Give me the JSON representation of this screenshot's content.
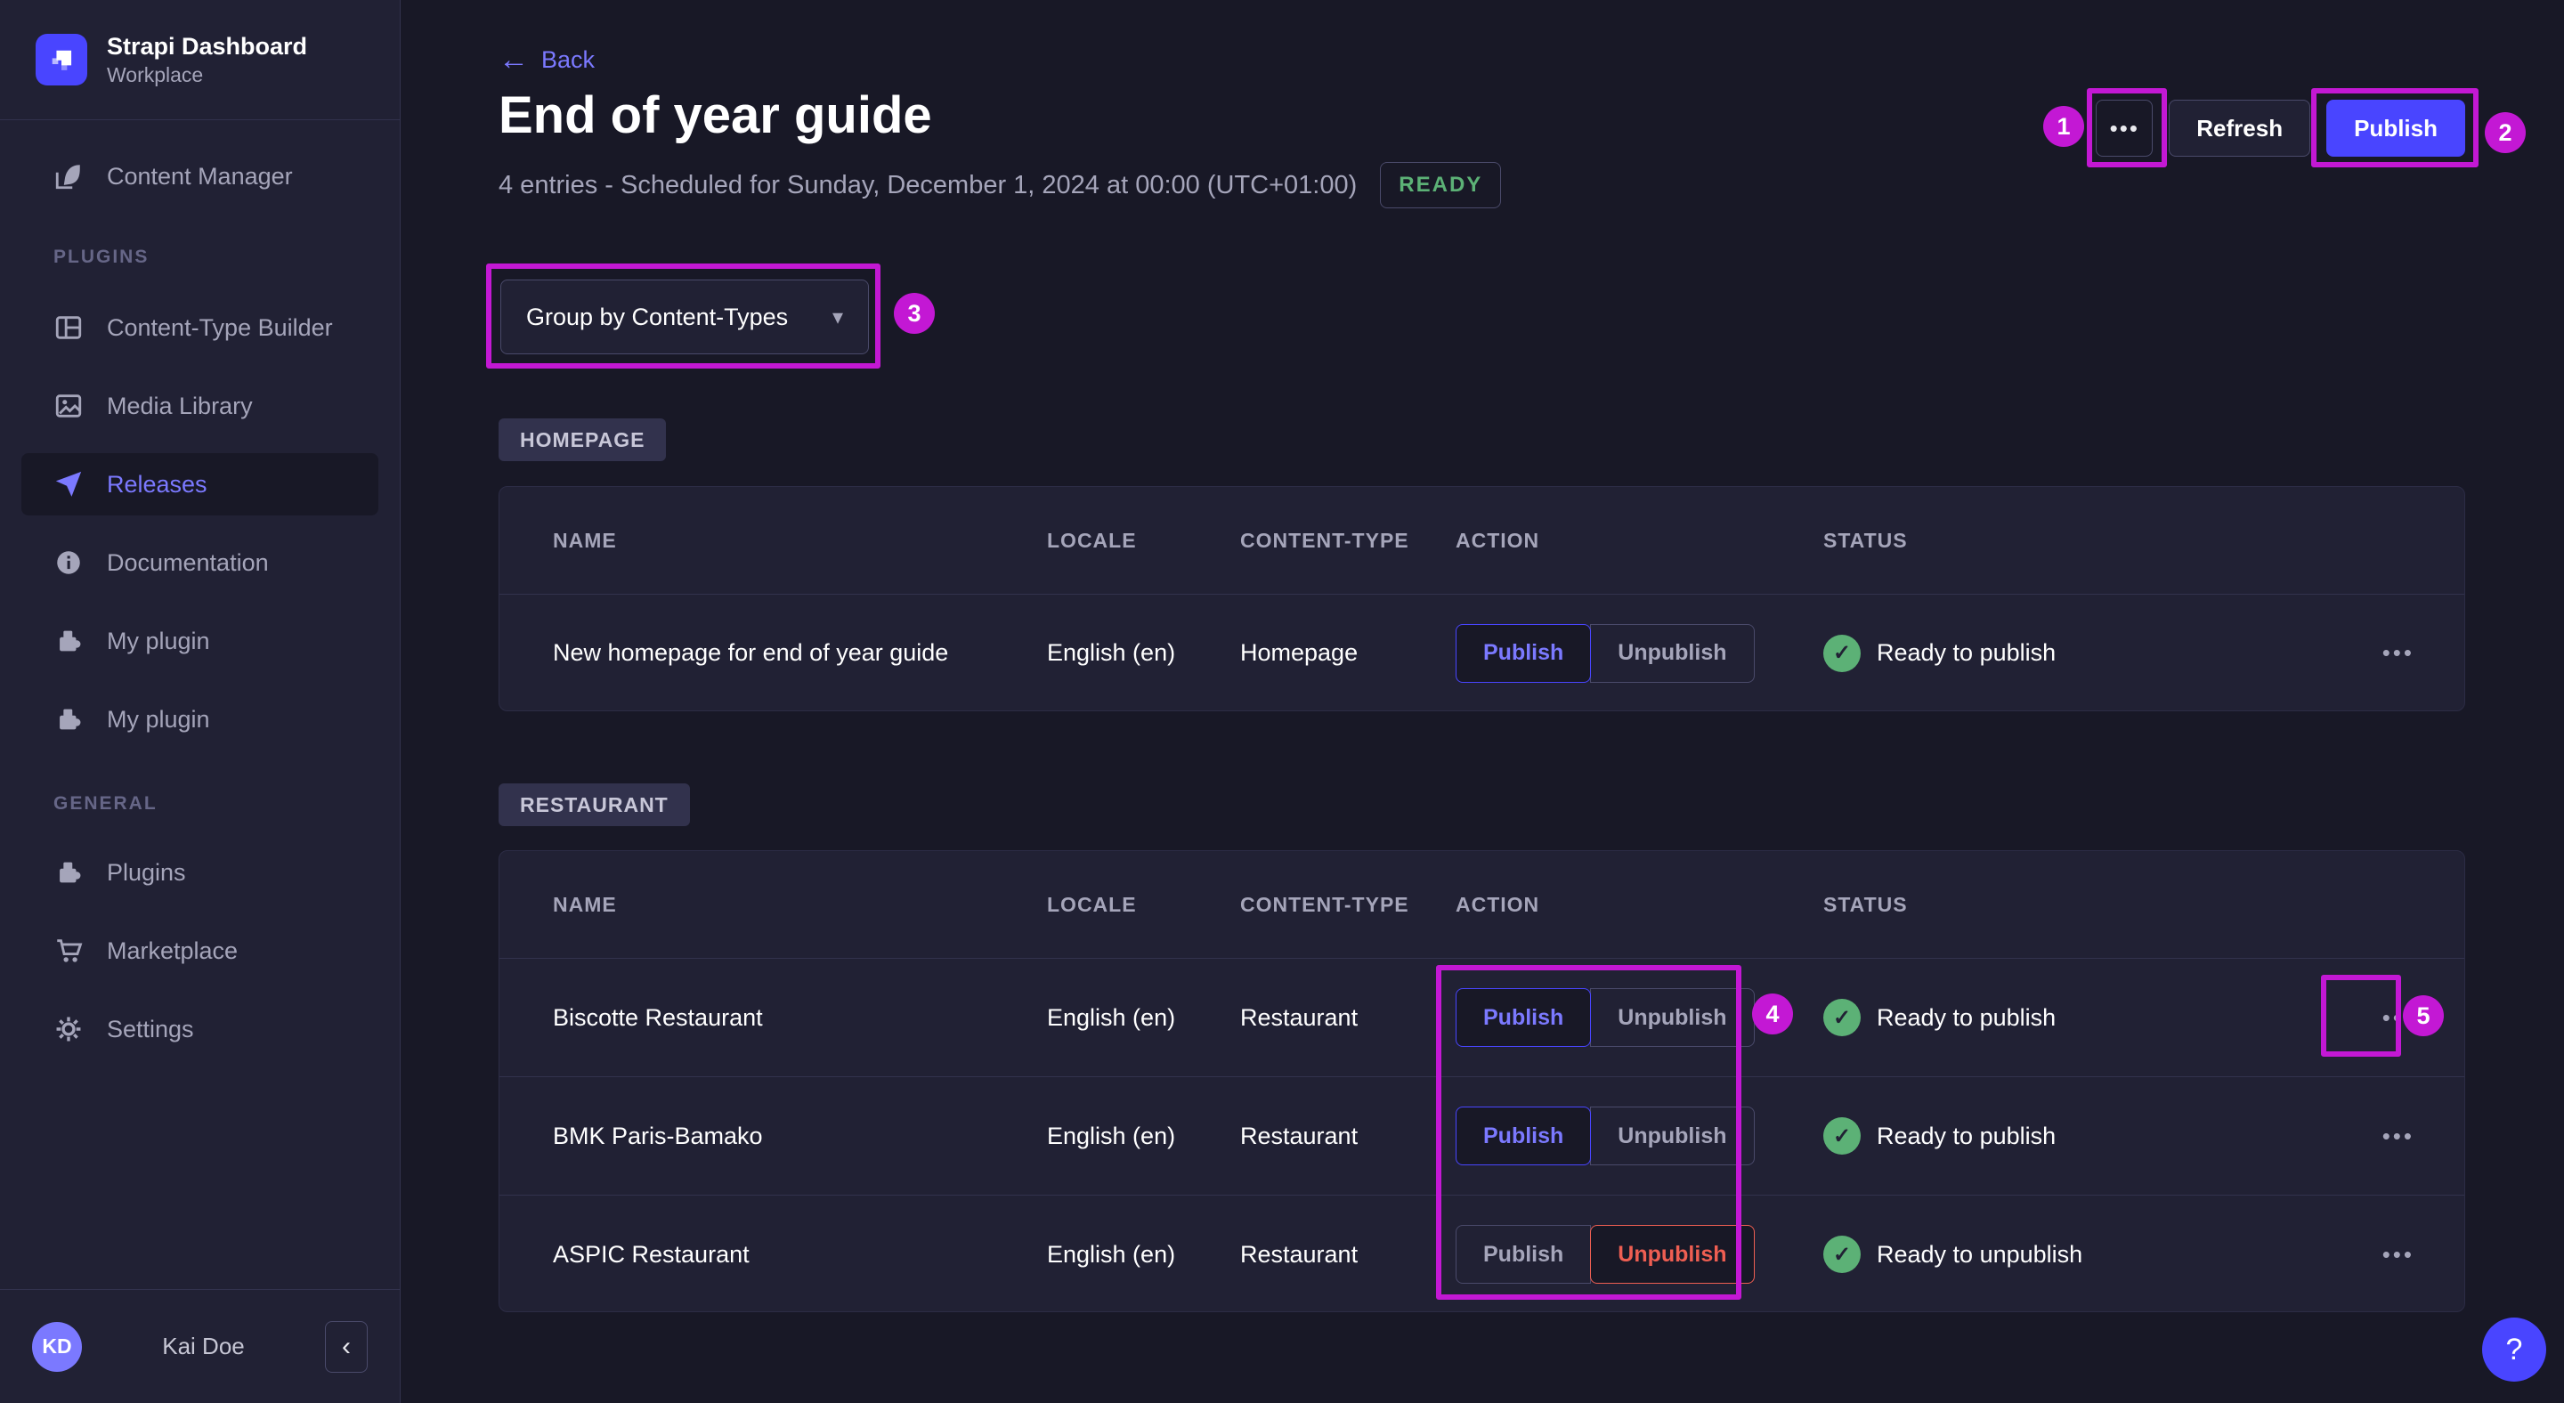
{
  "sidebar": {
    "app_title": "Strapi Dashboard",
    "app_subtitle": "Workplace",
    "content_manager": "Content Manager",
    "sections": [
      {
        "header": "PLUGINS",
        "items": [
          "Content-Type Builder",
          "Media Library",
          "Releases",
          "Documentation",
          "My plugin",
          "My plugin"
        ]
      },
      {
        "header": "GENERAL",
        "items": [
          "Plugins",
          "Marketplace",
          "Settings"
        ]
      }
    ],
    "user": {
      "initials": "KD",
      "name": "Kai Doe"
    }
  },
  "header": {
    "back": "Back",
    "title": "End of year guide",
    "subtitle": "4 entries - Scheduled for Sunday, December 1, 2024 at 00:00 (UTC+01:00)",
    "ready_badge": "READY",
    "refresh": "Refresh",
    "publish": "Publish"
  },
  "group_by": {
    "value": "Group by Content-Types"
  },
  "groups": [
    {
      "badge": "HOMEPAGE",
      "columns": [
        "NAME",
        "LOCALE",
        "CONTENT-TYPE",
        "ACTION",
        "STATUS"
      ],
      "rows": [
        {
          "name": "New homepage for end of year guide",
          "locale": "English (en)",
          "content_type": "Homepage",
          "publish": "Publish",
          "unpublish": "Unpublish",
          "status": "Ready to publish"
        }
      ]
    },
    {
      "badge": "RESTAURANT",
      "columns": [
        "NAME",
        "LOCALE",
        "CONTENT-TYPE",
        "ACTION",
        "STATUS"
      ],
      "rows": [
        {
          "name": "Biscotte Restaurant",
          "locale": "English (en)",
          "content_type": "Restaurant",
          "publish": "Publish",
          "unpublish": "Unpublish",
          "status": "Ready to publish"
        },
        {
          "name": "BMK Paris-Bamako",
          "locale": "English (en)",
          "content_type": "Restaurant",
          "publish": "Publish",
          "unpublish": "Unpublish",
          "status": "Ready to publish"
        },
        {
          "name": "ASPIC Restaurant",
          "locale": "English (en)",
          "content_type": "Restaurant",
          "publish": "Publish",
          "unpublish": "Unpublish",
          "status": "Ready to unpublish"
        }
      ]
    }
  ],
  "annotations": [
    "1",
    "2",
    "3",
    "4",
    "5"
  ],
  "icons": {
    "more": "•••",
    "back_arrow": "←",
    "caret_down": "▾",
    "check": "✓",
    "collapse": "‹",
    "help": "?"
  },
  "colors": {
    "page_bg": "#181826",
    "panel_bg": "#212134",
    "divider": "#32324d",
    "primary": "#4945ff",
    "primary_light": "#7b79ff",
    "success": "#5cb176",
    "danger": "#ee5e52",
    "annotation": "#c318d4",
    "text_muted": "#a5a5ba"
  }
}
